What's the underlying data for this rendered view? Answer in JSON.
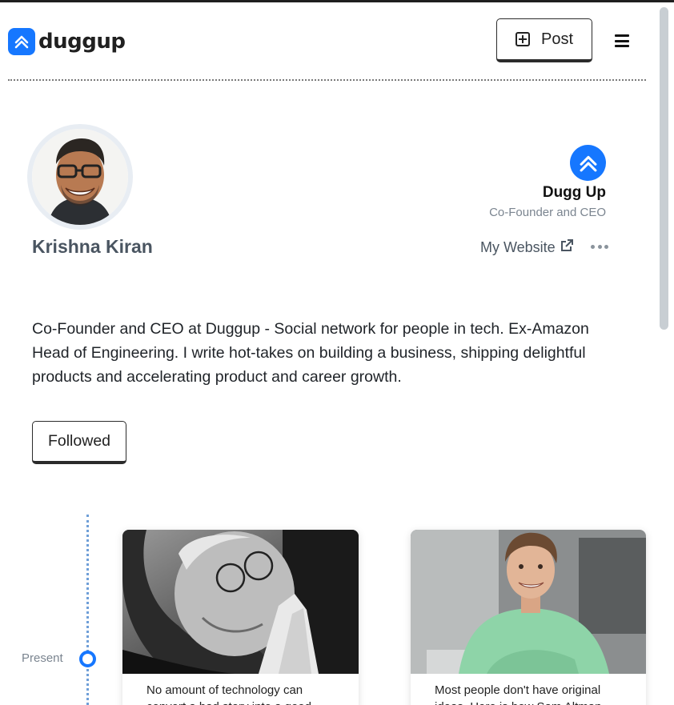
{
  "header": {
    "logo_text": "duggup",
    "post_label": "Post"
  },
  "profile": {
    "name": "Krishna Kiran",
    "company_name": "Dugg Up",
    "company_role": "Co-Founder and CEO",
    "website_label": "My Website",
    "bio": "Co-Founder and CEO at Duggup - Social network for people in tech. Ex-Amazon Head of Engineering. I write hot-takes on building a business, shipping delightful products and accelerating product and career growth.",
    "follow_label": "Followed"
  },
  "timeline": {
    "present_label": "Present"
  },
  "posts": [
    {
      "text": "No amount of technology can convert a bad story into a good"
    },
    {
      "text": "Most people don't have original ideas. Here is how Sam Altman"
    }
  ],
  "colors": {
    "brand": "#1677ff",
    "text_muted": "#7b8590",
    "name_color": "#4a5561"
  }
}
